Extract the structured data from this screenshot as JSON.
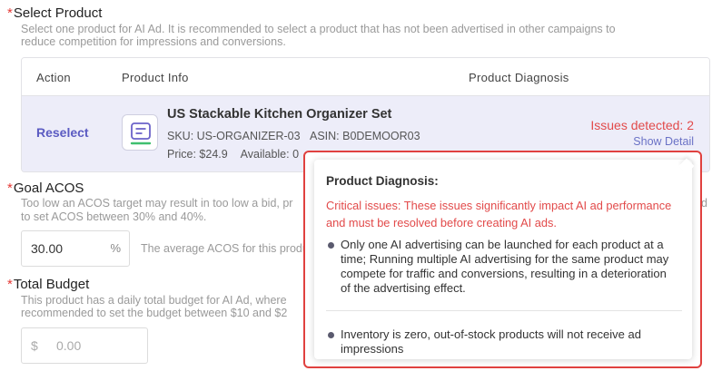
{
  "select_product": {
    "title": "Select Product",
    "required_mark": "*",
    "desc_line1": "Select one product for AI Ad. It is recommended to select a product that has not been advertised in other campaigns to",
    "desc_line2": "reduce competition for impressions and conversions."
  },
  "table": {
    "headers": [
      "Action",
      "Product Info",
      "Product Diagnosis"
    ],
    "row": {
      "action": "Reselect",
      "product_name": "US Stackable Kitchen Organizer Set",
      "sku": "SKU: US-ORGANIZER-03",
      "asin": "ASIN: B0DEMOOR03",
      "price": "Price: $24.9",
      "available": "Available: 0",
      "issues": "Issues detected: 2",
      "show_detail": "Show Detail",
      "icon": "product-document-icon"
    }
  },
  "goal_acos": {
    "title": "Goal ACOS",
    "required_mark": "*",
    "desc_line1": "Too low an ACOS target may result in too low a bid, pr",
    "desc_line1_tail": "ed",
    "desc_line2": "to set ACOS between 30% and 40%.",
    "value": "30.00",
    "unit": "%",
    "hint": "The average ACOS for this produ"
  },
  "total_budget": {
    "title": "Total Budget",
    "required_mark": "*",
    "desc_line1": "This product has a daily total budget for AI Ad, where",
    "desc_line2": "recommended to set the budget between $10 and $2",
    "currency": "$",
    "placeholder": "0.00"
  },
  "diagnosis_popover": {
    "title": "Product Diagnosis:",
    "critical": "Critical issues: These issues significantly impact AI ad performance and must be resolved before creating AI ads.",
    "items": [
      "Only one AI advertising can be launched for each product at a time; Running multiple AI advertising for the same product may compete for traffic and conversions, resulting in a deterioration of the advertising effect.",
      "Inventory is zero, out-of-stock products will not receive ad impressions"
    ]
  },
  "colors": {
    "accent": "#5b5bc2",
    "error": "#e24a4a",
    "row_bg": "#ededf9"
  }
}
